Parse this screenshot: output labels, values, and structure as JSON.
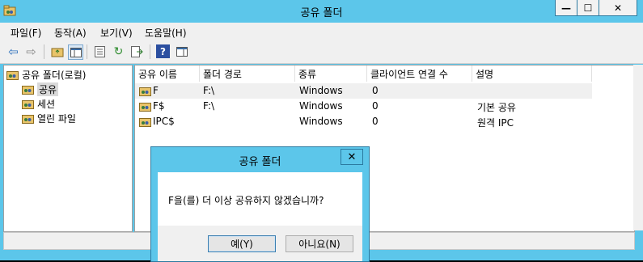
{
  "window": {
    "title": "공유 폴더",
    "controls": {
      "minimize": "—",
      "maximize": "☐",
      "close": "✕"
    }
  },
  "menu": [
    "파일(F)",
    "동작(A)",
    "보기(V)",
    "도움말(H)"
  ],
  "tree": {
    "root": "공유 폴더(로컬)",
    "children": [
      "공유",
      "세션",
      "열린 파일"
    ]
  },
  "list": {
    "columns": [
      "공유 이름",
      "폴더 경로",
      "종류",
      "클라이언트 연결 수",
      "설명"
    ],
    "rows": [
      {
        "name": "F",
        "path": "F:\\",
        "type": "Windows",
        "clients": "0",
        "desc": ""
      },
      {
        "name": "F$",
        "path": "F:\\",
        "type": "Windows",
        "clients": "0",
        "desc": "기본 공유"
      },
      {
        "name": "IPC$",
        "path": "",
        "type": "Windows",
        "clients": "0",
        "desc": "원격 IPC"
      }
    ]
  },
  "dialog": {
    "title": "공유 폴더",
    "close": "✕",
    "message": "F을(를) 더 이상 공유하지 않겠습니까?",
    "yes": "예(Y)",
    "no": "아니요(N)"
  },
  "colors": {
    "chrome": "#5cc6ea",
    "panel": "#f0f0f0"
  }
}
